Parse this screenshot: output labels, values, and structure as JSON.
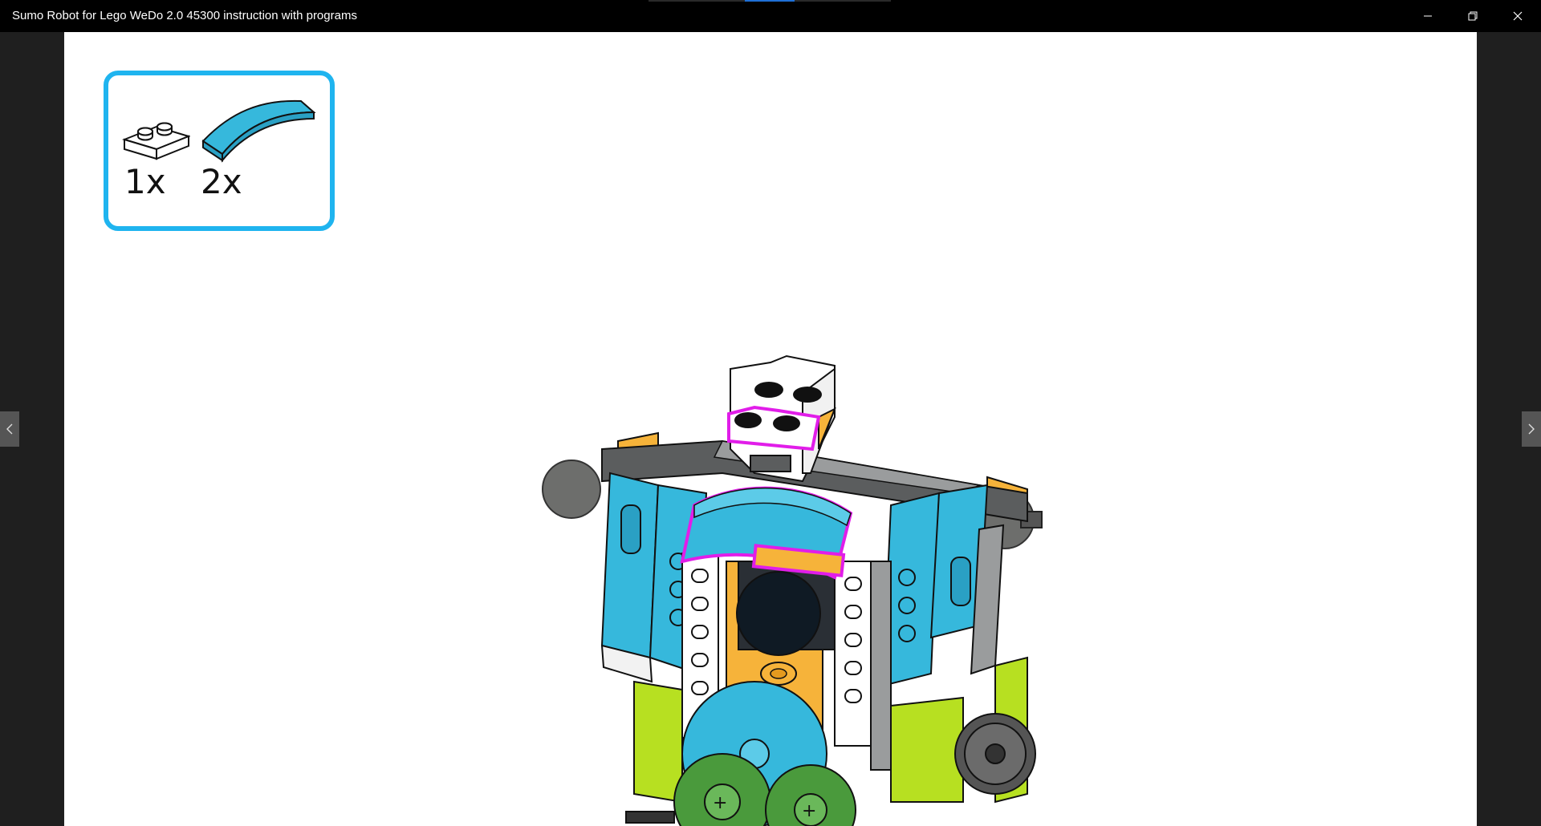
{
  "window": {
    "title": "Sumo Robot for Lego WeDo 2.0 45300 instruction with programs",
    "accent_color": "#1fb4ef"
  },
  "controls": {
    "minimize_icon": "minimize-icon",
    "restore_icon": "restore-icon",
    "close_icon": "close-icon"
  },
  "navigation": {
    "prev_icon": "chevron-left-icon",
    "next_icon": "chevron-right-icon"
  },
  "parts_needed": {
    "items": [
      {
        "part": "plate 1x2 white",
        "quantity": "1x"
      },
      {
        "part": "curved slope 1x4 medium azure",
        "quantity": "2x"
      }
    ]
  },
  "colors": {
    "highlight": "#e11de9",
    "azure": "#36b8dc",
    "yellow_orange": "#f6b33a",
    "lime": "#b7e021",
    "dark_gray": "#5b5d5e",
    "white": "#ffffff"
  }
}
